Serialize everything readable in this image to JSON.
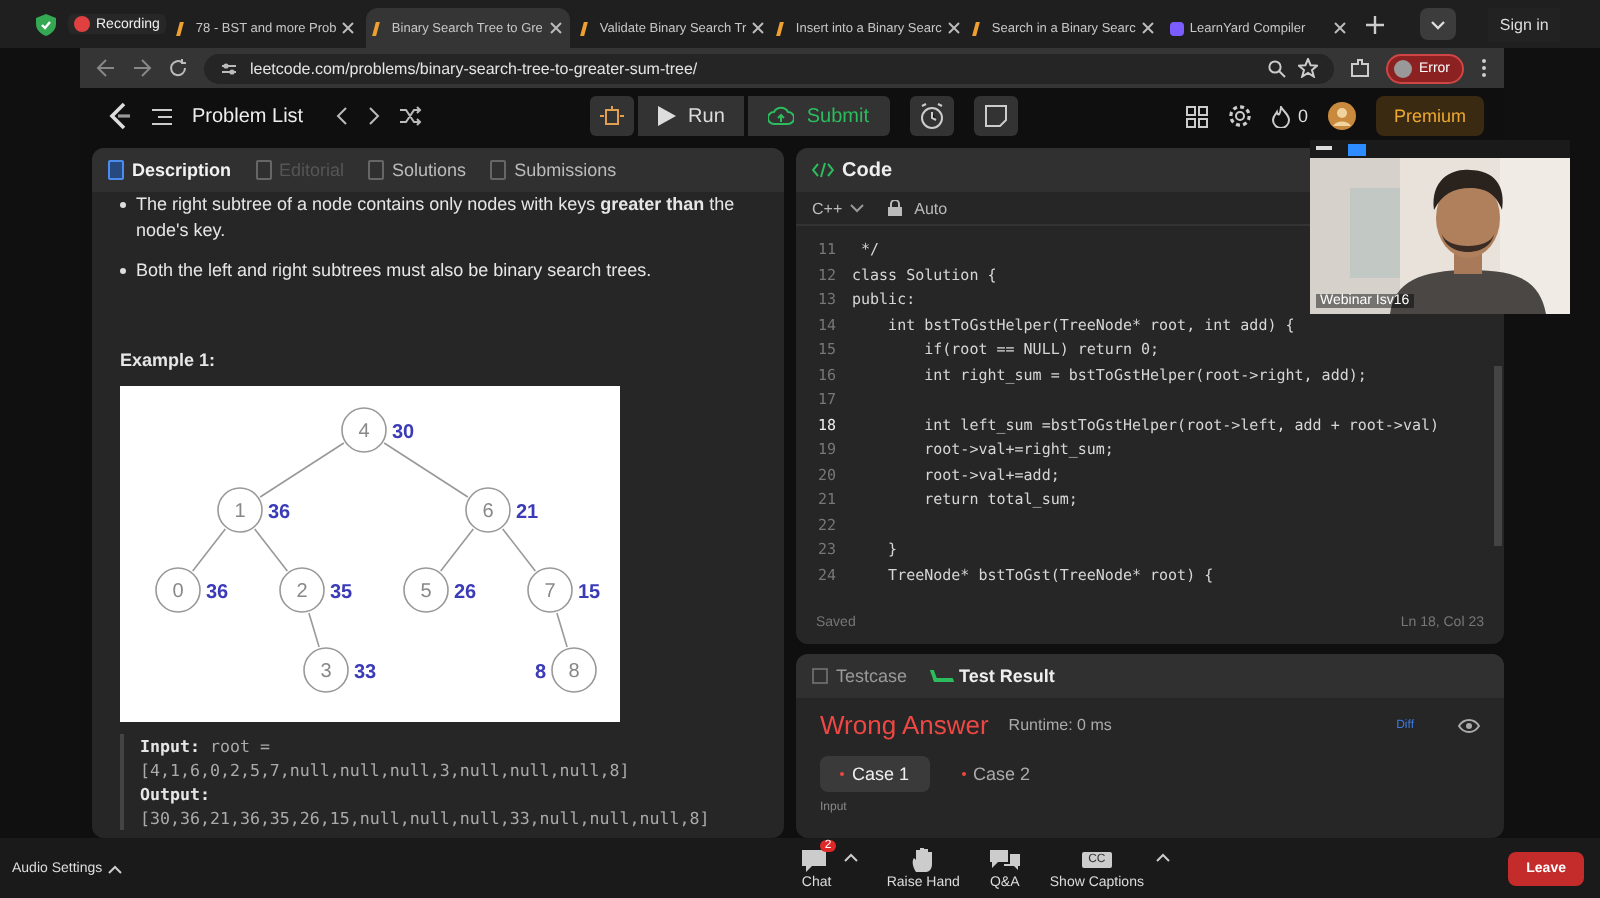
{
  "browser": {
    "tabs": [
      {
        "title": "78 - BST and more Prob",
        "selected": false
      },
      {
        "title": "Binary Search Tree to Gre",
        "selected": true
      },
      {
        "title": "Validate Binary Search Tr",
        "selected": false
      },
      {
        "title": "Insert into a Binary Searc",
        "selected": false
      },
      {
        "title": "Search in a Binary Searc",
        "selected": false
      },
      {
        "title": "LearnYard Compiler",
        "selected": false
      }
    ],
    "sign_in": "Sign in",
    "url": "leetcode.com/problems/binary-search-tree-to-greater-sum-tree/",
    "profile_status": "Error"
  },
  "recording": "Recording",
  "header": {
    "problem_list": "Problem List",
    "run": "Run",
    "submit": "Submit",
    "streak": "0",
    "premium": "Premium"
  },
  "description": {
    "tabs": [
      {
        "label": "Description",
        "selected": true,
        "disabled": false
      },
      {
        "label": "Editorial",
        "selected": false,
        "disabled": true
      },
      {
        "label": "Solutions",
        "selected": false,
        "disabled": false
      },
      {
        "label": "Submissions",
        "selected": false,
        "disabled": false
      }
    ],
    "bullets": [
      "The right subtree of a node contains only nodes with keys **greater than** the node's key.",
      "Both the left and right subtrees must also be binary search trees."
    ],
    "example_title": "Example 1:",
    "tree": {
      "value": "4",
      "sum": "30",
      "left": {
        "value": "1",
        "sum": "36",
        "left": {
          "value": "0",
          "sum": "36"
        },
        "right": {
          "value": "2",
          "sum": "35",
          "right": {
            "value": "3",
            "sum": "33"
          }
        }
      },
      "right": {
        "value": "6",
        "sum": "21",
        "left": {
          "value": "5",
          "sum": "26"
        },
        "right": {
          "value": "7",
          "sum": "15",
          "right": {
            "value": "8",
            "sum": "8"
          }
        }
      }
    },
    "input_label": "Input:",
    "input_value": "root = [4,1,6,0,2,5,7,null,null,null,3,null,null,null,8]",
    "output_label": "Output:",
    "output_value": "[30,36,21,36,35,26,15,null,null,null,33,null,null,null,8]"
  },
  "code": {
    "title": "Code",
    "language": "C++",
    "mode": "Auto",
    "lines": [
      {
        "n": "11",
        "text": " */",
        "current": false
      },
      {
        "n": "12",
        "text": "class Solution {",
        "current": false
      },
      {
        "n": "13",
        "text": "public:",
        "current": false
      },
      {
        "n": "14",
        "text": "    int bstToGstHelper(TreeNode* root, int add) {",
        "current": false
      },
      {
        "n": "15",
        "text": "        if(root == NULL) return 0;",
        "current": false
      },
      {
        "n": "16",
        "text": "        int right_sum = bstToGstHelper(root->right, add);",
        "current": false
      },
      {
        "n": "17",
        "current": false
      },
      {
        "n": "18",
        "text": "        int left_sum =bstToGstHelper(root->left, add + root->val)",
        "current": true
      },
      {
        "n": "19",
        "text": "        root->val+=right_sum;",
        "current": false
      },
      {
        "n": "20",
        "text": "        root->val+=add;",
        "current": false
      },
      {
        "n": "21",
        "text": "        return total_sum;",
        "current": false
      },
      {
        "n": "22",
        "current": false
      },
      {
        "n": "23",
        "text": "    }",
        "current": false
      },
      {
        "n": "24",
        "text": "    TreeNode* bstToGst(TreeNode* root) {",
        "current": false
      }
    ],
    "status": "Saved",
    "position": "Ln 18, Col 23"
  },
  "tests": {
    "tabs": [
      {
        "label": "Testcase",
        "selected": false
      },
      {
        "label": "Test Result",
        "selected": true
      }
    ],
    "verdict": "Wrong Answer",
    "runtime": "Runtime: 0 ms",
    "diff": "Diff",
    "cases": [
      {
        "label": "Case 1",
        "selected": true
      },
      {
        "label": "Case 2",
        "selected": false
      }
    ],
    "input_label": "Input"
  },
  "video": {
    "name": "Webinar Isv16"
  },
  "meeting": {
    "audio_settings": "Audio Settings",
    "controls": [
      {
        "kind": "chat",
        "label": "Chat",
        "badge": "2",
        "has_menu": true
      },
      {
        "kind": "hand",
        "label": "Raise Hand",
        "has_menu": false
      },
      {
        "kind": "qa",
        "label": "Q&A",
        "has_menu": false
      },
      {
        "kind": "captions",
        "label": "Show Captions",
        "icon_text": "CC",
        "has_menu": true
      }
    ],
    "leave": "Leave"
  }
}
